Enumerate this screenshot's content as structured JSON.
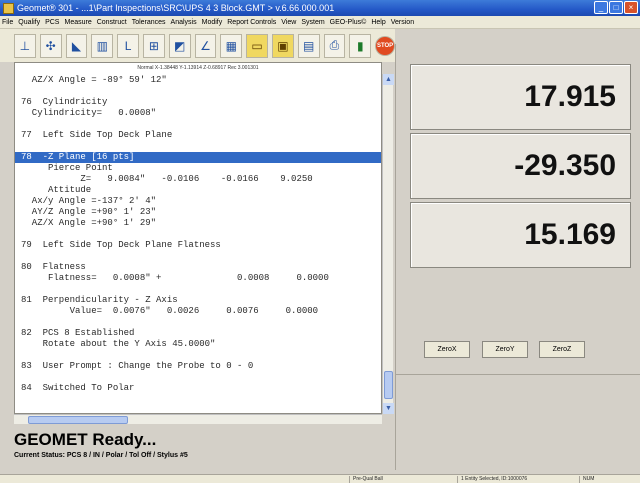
{
  "window": {
    "title": "Geomet® 301 - ...1\\Part Inspections\\SRC\\UPS 4 3 Block.GMT > v.6.66.000.001"
  },
  "menu": [
    "File",
    "Qualify",
    "PCS",
    "Measure",
    "Construct",
    "Tolerances",
    "Analysis",
    "Modify",
    "Report Controls",
    "View",
    "System",
    "GEO-Plus©",
    "Help",
    "Version"
  ],
  "toolbar": {
    "icons": [
      "axis-icon",
      "probe-icon",
      "measure-icon",
      "chart-icon",
      "tolerance-icon",
      "construct-icon",
      "plane-icon",
      "angle-icon",
      "report-icon",
      "folder-open-icon",
      "folder-icon",
      "save-icon",
      "print-icon",
      "stats-icon",
      "stop-icon"
    ]
  },
  "report": {
    "normal_line": "Normal X-1.38448 Y-1.13914 Z-0.68917 Rec 3.001301",
    "lines": [
      "  AZ/X Angle = -89° 59' 12\"",
      "",
      "76  Cylindricity",
      "  Cylindricity=   0.0008\"",
      "",
      "77  Left Side Top Deck Plane",
      "",
      "78  -Z Plane [16 pts]",
      "     Pierce Point",
      "           Z=   9.0084\"   -0.0106    -0.0166    9.0250",
      "     Attitude",
      "  Ax/y Angle =-137° 2' 4\"",
      "  AY/Z Angle =+90° 1' 23\"",
      "  AZ/X Angle =+90° 1' 29\"",
      "",
      "79  Left Side Top Deck Plane Flatness",
      "",
      "80  Flatness",
      "     Flatness=   0.0008\" +              0.0008     0.0000",
      "",
      "81  Perpendicularity - Z Axis",
      "         Value=  0.0076\"   0.0026     0.0076     0.0000",
      "",
      "82  PCS 8 Established",
      "    Rotate about the Y Axis 45.0000\"",
      "",
      "83  User Prompt : Change the Probe to 0 - 0",
      "",
      "84  Switched To Polar"
    ],
    "selected_index": 7
  },
  "dro": {
    "x": "17.915",
    "y": "-29.350",
    "z": "15.169"
  },
  "zero_buttons": {
    "x": "ZeroX",
    "y": "ZeroY",
    "z": "ZeroZ"
  },
  "status": {
    "ready": "GEOMET Ready...",
    "current": "Current Status: PCS 8 / IN / Polar / Tol Off / Stylus #5"
  },
  "statusbar": {
    "mode": "Pre-Qual Ball",
    "selection": "1 Entity Selected, ID:1000076",
    "num": "NUM"
  },
  "colors": {
    "selection": "#316ac5",
    "title_bar": "#2458c7"
  }
}
